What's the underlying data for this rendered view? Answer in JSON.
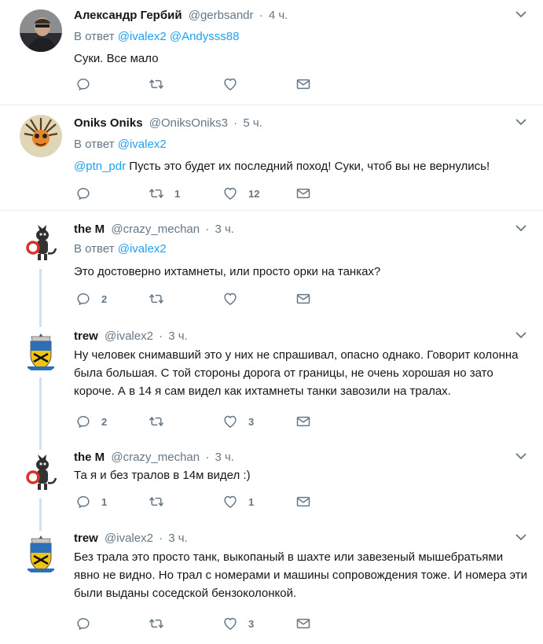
{
  "tweets": [
    {
      "fullname": "Александр Гербий",
      "username": "@gerbsandr",
      "time": "4 ч.",
      "reply_prefix": "В ответ",
      "reply_to": [
        "@ivalex2",
        "@Andysss88"
      ],
      "mention": "",
      "text": "Суки. Все мало",
      "replies": "",
      "retweets": "",
      "likes": ""
    },
    {
      "fullname": "Oniks Oniks",
      "username": "@OniksOniks3",
      "time": "5 ч.",
      "reply_prefix": "В ответ",
      "reply_to": [
        "@ivalex2"
      ],
      "mention": "@ptn_pdr",
      "text": "Пусть это будет их последний поход! Суки, чтоб вы не вернулись!",
      "replies": "",
      "retweets": "1",
      "likes": "12"
    },
    {
      "fullname": "the M",
      "username": "@crazy_mechan",
      "time": "3 ч.",
      "reply_prefix": "В ответ",
      "reply_to": [
        "@ivalex2"
      ],
      "mention": "",
      "text": "Это достоверно ихтамнеты, или просто орки на танках?",
      "replies": "2",
      "retweets": "",
      "likes": ""
    },
    {
      "fullname": "trew",
      "username": "@ivalex2",
      "time": "3 ч.",
      "reply_prefix": "",
      "reply_to": [],
      "mention": "",
      "text": "Ну человек снимавший это у них не спрашивал, опасно однако. Говорит колонна была большая. С той стороны дорога от границы, не очень хорошая но зато короче. А в 14 я сам видел как ихтамнеты танки завозили на тралах.",
      "replies": "2",
      "retweets": "",
      "likes": "3"
    },
    {
      "fullname": "the M",
      "username": "@crazy_mechan",
      "time": "3 ч.",
      "reply_prefix": "",
      "reply_to": [],
      "mention": "",
      "text": "Та я и без тралов в 14м видел :)",
      "replies": "1",
      "retweets": "",
      "likes": "1"
    },
    {
      "fullname": "trew",
      "username": "@ivalex2",
      "time": "3 ч.",
      "reply_prefix": "",
      "reply_to": [],
      "mention": "",
      "text": "Без трала это просто танк, выкопаный в шахте или завезеный мышебратьями явно не видно. Но трал с номерами и машины сопровождения тоже. И номера эти были выданы соседской бензоколонкой.",
      "replies": "",
      "retweets": "",
      "likes": "3"
    }
  ],
  "icons": {
    "reply": "reply-icon",
    "retweet": "retweet-icon",
    "like": "heart-icon",
    "dm": "envelope-icon",
    "menu": "chevron-down-icon"
  },
  "colors": {
    "link": "#1da1f2",
    "muted": "#657786",
    "thread_line": "#cce3f1",
    "separator": "#e6ecf0"
  }
}
